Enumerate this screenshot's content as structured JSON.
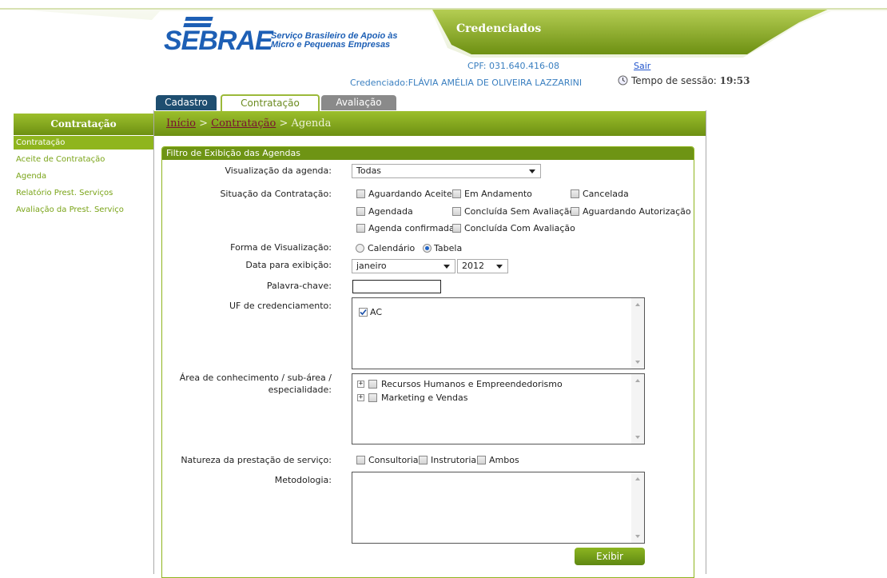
{
  "header": {
    "brand": "SEBRAE",
    "tagline_1": "Serviço Brasileiro de Apoio às",
    "tagline_2": "Micro e Pequenas Empresas",
    "title": "Credenciados",
    "cpf": "CPF: 031.640.416-08",
    "logout": "Sair",
    "credenciado": "Credenciado:FLÁVIA AMÉLIA DE OLIVEIRA LAZZARINI",
    "session_label": "Tempo de sessão:",
    "session_time": "19:53"
  },
  "tabs": [
    {
      "label": "Cadastro"
    },
    {
      "label": "Contratação"
    },
    {
      "label": "Avaliação"
    }
  ],
  "breadcrumb": {
    "home": "Início",
    "sep": ">",
    "section": "Contratação",
    "current": "Agenda"
  },
  "sidebar": {
    "title": "Contratação",
    "items": [
      {
        "label": "Contratação"
      },
      {
        "label": "Aceite de Contratação"
      },
      {
        "label": "Agenda"
      },
      {
        "label": "Relatório Prest. Serviços"
      },
      {
        "label": "Avaliação da Prest. Serviço"
      }
    ]
  },
  "filter": {
    "title": "Filtro de Exibição das Agendas",
    "visualizacao_label": "Visualização da agenda:",
    "visualizacao_value": "Todas",
    "situacao_label": "Situação da Contratação:",
    "situacao_options": [
      "Aguardando Aceite",
      "Em Andamento",
      "Cancelada",
      "Agendada",
      "Concluída Sem Avaliação",
      "Aguardando Autorização",
      "Agenda confirmada",
      "Concluída Com Avaliação"
    ],
    "forma_label": "Forma de Visualização:",
    "forma_options": [
      "Calendário",
      "Tabela"
    ],
    "forma_selected": "Tabela",
    "data_label": "Data para exibição:",
    "mes_value": "janeiro",
    "ano_value": "2012",
    "palavra_label": "Palavra-chave:",
    "palavra_value": "",
    "uf_label": "UF de credenciamento:",
    "uf_items": [
      {
        "label": "AC",
        "checked": true
      }
    ],
    "area_label_1": "Área de conhecimento / sub-área /",
    "area_label_2": "especialidade:",
    "area_items": [
      "Recursos Humanos e Empreendedorismo",
      "Marketing e Vendas"
    ],
    "natureza_label": "Natureza da prestação de serviço:",
    "natureza_options": [
      "Consultoria",
      "Instrutoria",
      "Ambos"
    ],
    "metodologia_label": "Metodologia:",
    "submit": "Exibir"
  },
  "colors": {
    "brand_green": "#6e9414",
    "brand_blue": "#1d5fb5",
    "tab_dark": "#1e4e70"
  }
}
